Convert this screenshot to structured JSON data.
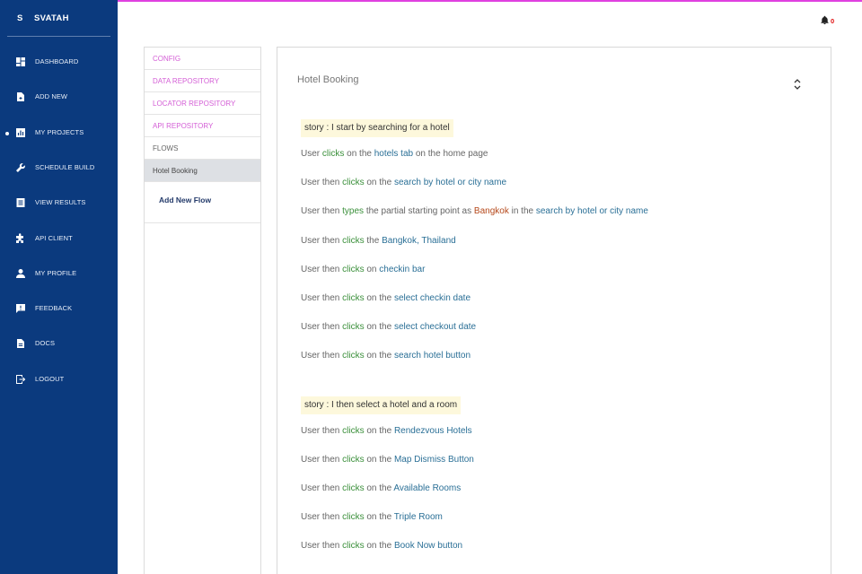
{
  "brand": {
    "initial": "S",
    "name": "SVATAH"
  },
  "nav": [
    {
      "label": "DASHBOARD",
      "icon": "dashboard-icon",
      "active": false
    },
    {
      "label": "ADD NEW",
      "icon": "file-add-icon",
      "active": false
    },
    {
      "label": "MY PROJECTS",
      "icon": "chart-icon",
      "active": true
    },
    {
      "label": "SCHEDULE BUILD",
      "icon": "wrench-icon",
      "active": false
    },
    {
      "label": "VIEW RESULTS",
      "icon": "list-icon",
      "active": false
    },
    {
      "label": "API CLIENT",
      "icon": "puzzle-icon",
      "active": false
    },
    {
      "label": "MY PROFILE",
      "icon": "user-icon",
      "active": false
    },
    {
      "label": "FEEDBACK",
      "icon": "feedback-icon",
      "active": false
    },
    {
      "label": "DOCS",
      "icon": "document-icon",
      "active": false
    },
    {
      "label": "LOGOUT",
      "icon": "logout-icon",
      "active": false
    }
  ],
  "notifications": {
    "icon": "bell-icon",
    "count": "0"
  },
  "mid_menu": {
    "items": [
      {
        "label": "CONFIG",
        "kind": "link"
      },
      {
        "label": "DATA REPOSITORY",
        "kind": "link"
      },
      {
        "label": "LOCATOR REPOSITORY",
        "kind": "link"
      },
      {
        "label": "API REPOSITORY",
        "kind": "link"
      },
      {
        "label": "FLOWS",
        "kind": "static"
      },
      {
        "label": "Hotel Booking",
        "kind": "active"
      }
    ],
    "add_flow_label": "Add New Flow"
  },
  "flow": {
    "title": "Hotel Booking",
    "collapse_icon": "chevron-up-down-icon",
    "stories": [
      {
        "label": "story : I start by searching for a hotel",
        "steps": [
          [
            [
              "User ",
              "p"
            ],
            [
              "clicks",
              "a"
            ],
            [
              " on the ",
              "p"
            ],
            [
              "hotels tab",
              "t"
            ],
            [
              " on the home page",
              "p"
            ]
          ],
          [
            [
              "User then ",
              "p"
            ],
            [
              "clicks",
              "a"
            ],
            [
              " on the ",
              "p"
            ],
            [
              "search by hotel or city name",
              "t"
            ]
          ],
          [
            [
              "User then ",
              "p"
            ],
            [
              "types",
              "a"
            ],
            [
              " the partial starting point as ",
              "p"
            ],
            [
              "Bangkok",
              "v"
            ],
            [
              " in the ",
              "p"
            ],
            [
              "search by hotel or city name",
              "t"
            ]
          ],
          [
            [
              "User then ",
              "p"
            ],
            [
              "clicks",
              "a"
            ],
            [
              " the ",
              "p"
            ],
            [
              "Bangkok, Thailand",
              "t"
            ]
          ],
          [
            [
              "User then ",
              "p"
            ],
            [
              "clicks",
              "a"
            ],
            [
              " on ",
              "p"
            ],
            [
              "checkin bar",
              "t"
            ]
          ],
          [
            [
              "User then ",
              "p"
            ],
            [
              "clicks",
              "a"
            ],
            [
              " on the ",
              "p"
            ],
            [
              "select checkin date",
              "t"
            ]
          ],
          [
            [
              "User then ",
              "p"
            ],
            [
              "clicks",
              "a"
            ],
            [
              " on the ",
              "p"
            ],
            [
              "select checkout date",
              "t"
            ]
          ],
          [
            [
              "User then ",
              "p"
            ],
            [
              "clicks",
              "a"
            ],
            [
              " on the ",
              "p"
            ],
            [
              "search hotel button",
              "t"
            ]
          ]
        ]
      },
      {
        "label": "story : I then select a hotel and a room",
        "steps": [
          [
            [
              "User then ",
              "p"
            ],
            [
              "clicks",
              "a"
            ],
            [
              " on the ",
              "p"
            ],
            [
              "Rendezvous Hotels",
              "t"
            ]
          ],
          [
            [
              "User then ",
              "p"
            ],
            [
              "clicks",
              "a"
            ],
            [
              " on the ",
              "p"
            ],
            [
              "Map Dismiss Button",
              "t"
            ]
          ],
          [
            [
              "User then ",
              "p"
            ],
            [
              "clicks",
              "a"
            ],
            [
              " on the ",
              "p"
            ],
            [
              "Available Rooms",
              "t"
            ]
          ],
          [
            [
              "User then ",
              "p"
            ],
            [
              "clicks",
              "a"
            ],
            [
              " on the ",
              "p"
            ],
            [
              "Triple Room",
              "t"
            ]
          ],
          [
            [
              "User then ",
              "p"
            ],
            [
              "clicks",
              "a"
            ],
            [
              " on the ",
              "p"
            ],
            [
              "Book Now button",
              "t"
            ]
          ]
        ]
      }
    ]
  }
}
